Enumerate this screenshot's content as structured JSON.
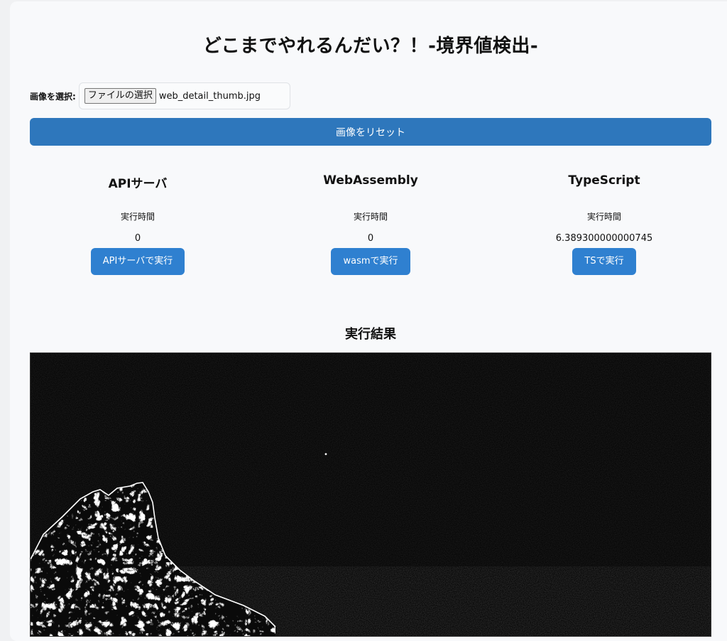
{
  "header": {
    "title": "どこまでやれるんだい？！-境界値検出-"
  },
  "file_input": {
    "label": "画像を選択:",
    "button_label": "ファイルの選択",
    "file_name": "web_detail_thumb.jpg"
  },
  "reset_button": {
    "label": "画像をリセット"
  },
  "engines": [
    {
      "title": "APIサーバ",
      "time_label": "実行時間",
      "time_value": "0",
      "button_label": "APIサーバで実行"
    },
    {
      "title": "WebAssembly",
      "time_label": "実行時間",
      "time_value": "0",
      "button_label": "wasmで実行"
    },
    {
      "title": "TypeScript",
      "time_label": "実行時間",
      "time_value": "6.389300000000745",
      "button_label": "TSで実行"
    }
  ],
  "result": {
    "title": "実行結果",
    "image_description_icon": "edge-detected-image"
  },
  "colors": {
    "primary_button": "#2f80d0",
    "reset_button": "#2e77bc",
    "card_background": "#f8f9fb",
    "result_background": "#050505"
  }
}
